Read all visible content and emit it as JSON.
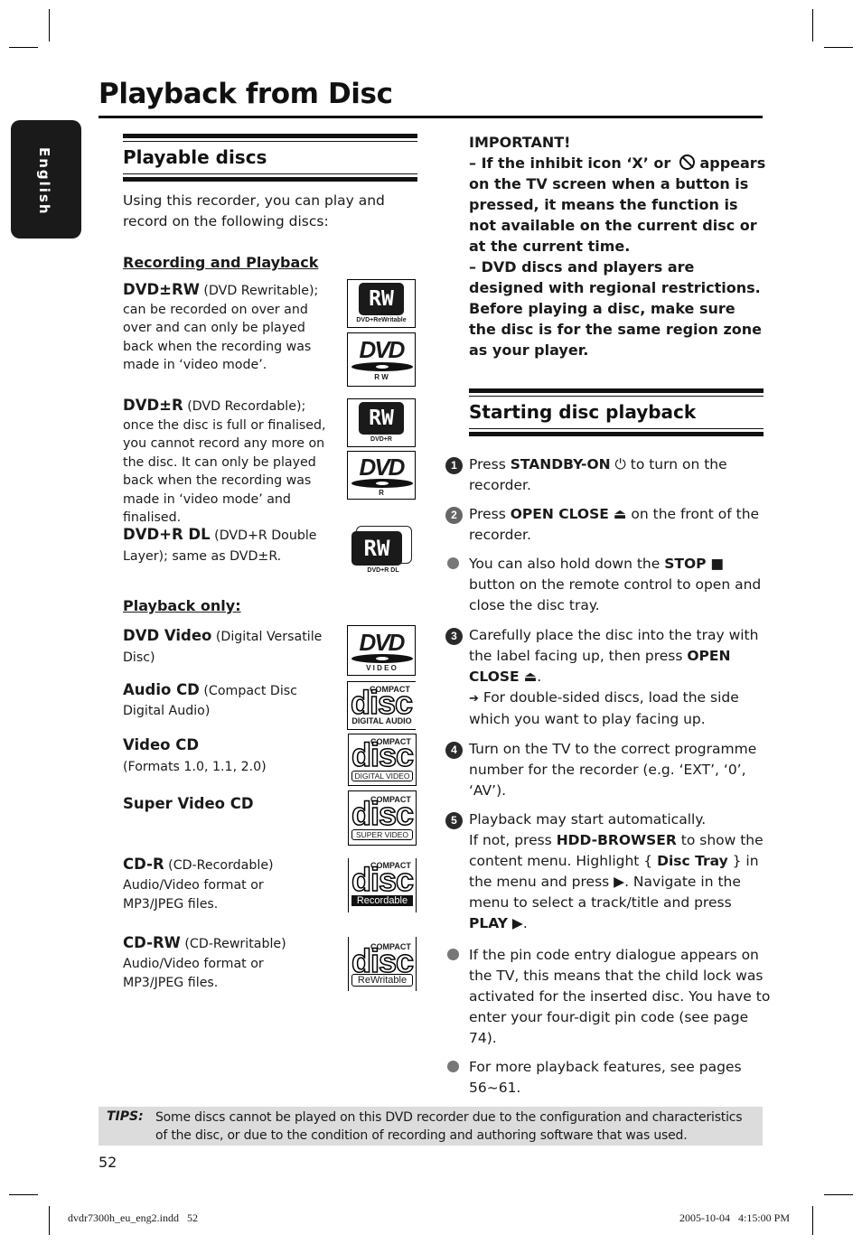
{
  "page": {
    "title": "Playback from Disc",
    "language_tab": "English",
    "page_number": "52",
    "slug_left": "dvdr7300h_eu_eng2.indd   52",
    "slug_right": "2005-10-04   4:15:00 PM"
  },
  "playable_discs": {
    "heading": "Playable discs",
    "intro": "Using this recorder, you can play and record on the following discs:",
    "rec_play_heading": "Recording and Playback",
    "playback_only_heading": "Playback only:",
    "items": [
      {
        "name": "DVD±RW",
        "desc": " (DVD Rewritable); can be recorded on over and over and can only be played back when the recording was made in ‘video mode’."
      },
      {
        "name": "DVD±R",
        "desc": " (DVD Recordable); once the disc is full or finalised, you cannot record any more on the disc.  It can only be played back when the recording was made in ‘video mode’ and finalised."
      },
      {
        "name": "DVD+R DL",
        "desc": " (DVD+R Double Layer); same as DVD±R."
      },
      {
        "name": "DVD Video",
        "desc": " (Digital Versatile Disc)"
      },
      {
        "name": "Audio CD",
        "desc": " (Compact Disc Digital Audio)"
      },
      {
        "name": "Video CD",
        "desc": "(Formats 1.0, 1.1, 2.0)"
      },
      {
        "name": "Super Video CD",
        "desc": ""
      },
      {
        "name": "CD-R",
        "desc_inline": " (CD-Recordable)",
        "desc": "Audio/Video format or MP3/JPEG files."
      },
      {
        "name": "CD-RW",
        "desc_inline": " (CD-Rewritable)",
        "desc": "Audio/Video format or MP3/JPEG files."
      }
    ],
    "logos": {
      "rw_mark": "RW",
      "dvd_mark": "DVD",
      "dvd_rewritable": "DVD+ReWritable",
      "dvd_r": "DVD+R",
      "dvd_r_dl": "DVD+R DL",
      "rw_caption": "R  W",
      "r_caption": "R",
      "video_caption": "V I D E O",
      "compact": "COMPACT",
      "disc": "disc",
      "digital_audio": "DIGITAL AUDIO",
      "digital_video": "DIGITAL VIDEO",
      "super_video": "SUPER VIDEO",
      "recordable": "Recordable",
      "rewritable": "ReWritable"
    }
  },
  "important": {
    "heading": "IMPORTANT!",
    "line1_a": "– If the inhibit icon ‘X’ or",
    "line1_b": "appears on the TV screen when a button is pressed, it means the function is not available on the current disc or at the current time.",
    "line2": "– DVD discs and players are designed with regional restrictions. Before playing a disc, make sure the disc is for the same region zone as your player."
  },
  "starting_playback": {
    "heading": "Starting disc playback",
    "steps": [
      {
        "num": "1",
        "pre": "Press ",
        "bold": "STANDBY-ON",
        "post": " to turn on the recorder."
      },
      {
        "num": "2",
        "pre": "Press ",
        "bold": "OPEN CLOSE",
        "post": " on the front of the recorder."
      },
      {
        "pre": "You can also hold down the ",
        "bold": "STOP",
        "post": " button on the remote control to open and close the disc tray."
      },
      {
        "num": "3",
        "pre": "Carefully place the disc into the tray with the label facing up, then press ",
        "bold": "OPEN CLOSE",
        "post": ".",
        "note": " For double-sided discs, load the side which you want to play facing up."
      },
      {
        "num": "4",
        "text": "Turn on the TV to the correct programme number for the recorder (e.g. ‘EXT’, ‘0’, ‘AV’)."
      },
      {
        "num": "5",
        "line1": "Playback may start automatically.",
        "pre": "If not, press ",
        "bold": "HDD-BROWSER",
        "mid": " to show the content menu. Highlight { ",
        "bold2": "Disc Tray",
        "mid2": " } in the menu and press ",
        "mid3": ".  Navigate in the menu to select a track/title and press ",
        "bold3": "PLAY",
        "post": "."
      },
      {
        "text": "If the pin code entry dialogue appears on the TV, this means that the child lock was activated for the inserted disc.  You have to enter your four-digit pin code (see page 74)."
      },
      {
        "text": "For more playback features, see pages 56~61."
      }
    ]
  },
  "tips": {
    "label": "TIPS:",
    "text": "Some discs cannot be played on this DVD recorder due to the configuration and characteristics of the disc, or due to the condition of recording and authoring software that was used."
  },
  "icons": {
    "power": "⏻",
    "eject": "⏏",
    "stop": "■",
    "play": "▶",
    "arrow": "➔"
  }
}
